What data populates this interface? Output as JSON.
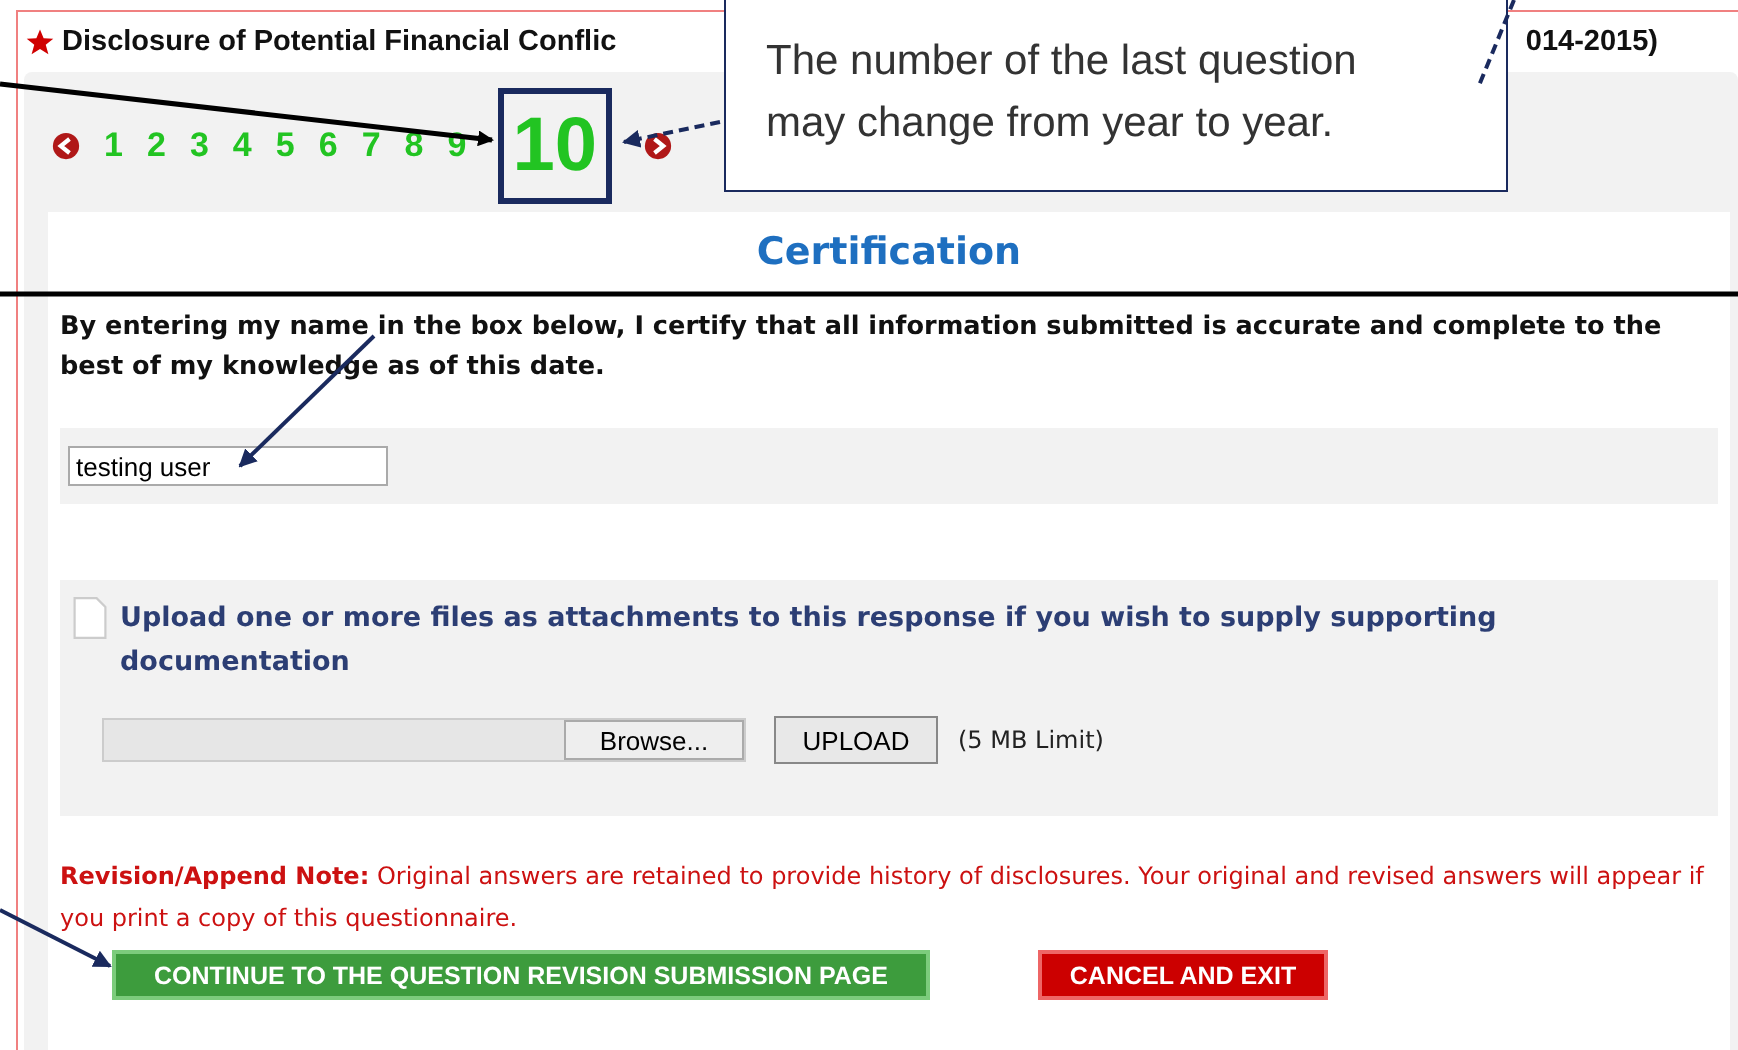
{
  "header": {
    "title_left": "Disclosure of Potential Financial Conflic",
    "title_right": "014-2015)"
  },
  "question_nav": [
    {
      "label": "1",
      "selected": false
    },
    {
      "label": "2",
      "selected": false
    },
    {
      "label": "3",
      "selected": false
    },
    {
      "label": "4",
      "selected": false
    },
    {
      "label": "5",
      "selected": false
    },
    {
      "label": "6",
      "selected": false
    },
    {
      "label": "7",
      "selected": false
    },
    {
      "label": "8",
      "selected": false
    },
    {
      "label": "9",
      "selected": false
    },
    {
      "label": "10",
      "selected": true
    }
  ],
  "callout": {
    "text": "The number of the last question may change from year to year."
  },
  "certification": {
    "title": "Certification",
    "statement": "By entering my name in the box below, I certify that all information submitted is accurate and complete to the best of my knowledge as of this date.",
    "name_value": "testing user"
  },
  "upload": {
    "heading": "Upload one or more files as attachments to this response if you wish to supply supporting documentation",
    "browse_label": "Browse...",
    "upload_label": "UPLOAD",
    "limit": "(5 MB Limit)"
  },
  "note": "**Revision/Append Note:** Original answers are retained to provide history of disclosures. Your original and revised answers will appear if you print a copy of this questionnaire.",
  "buttons": [
    {
      "label": "CONTINUE TO THE QUESTION REVISION SUBMISSION PAGE",
      "kind": "primary"
    },
    {
      "label": "CANCEL AND EXIT",
      "kind": "cancel"
    }
  ]
}
